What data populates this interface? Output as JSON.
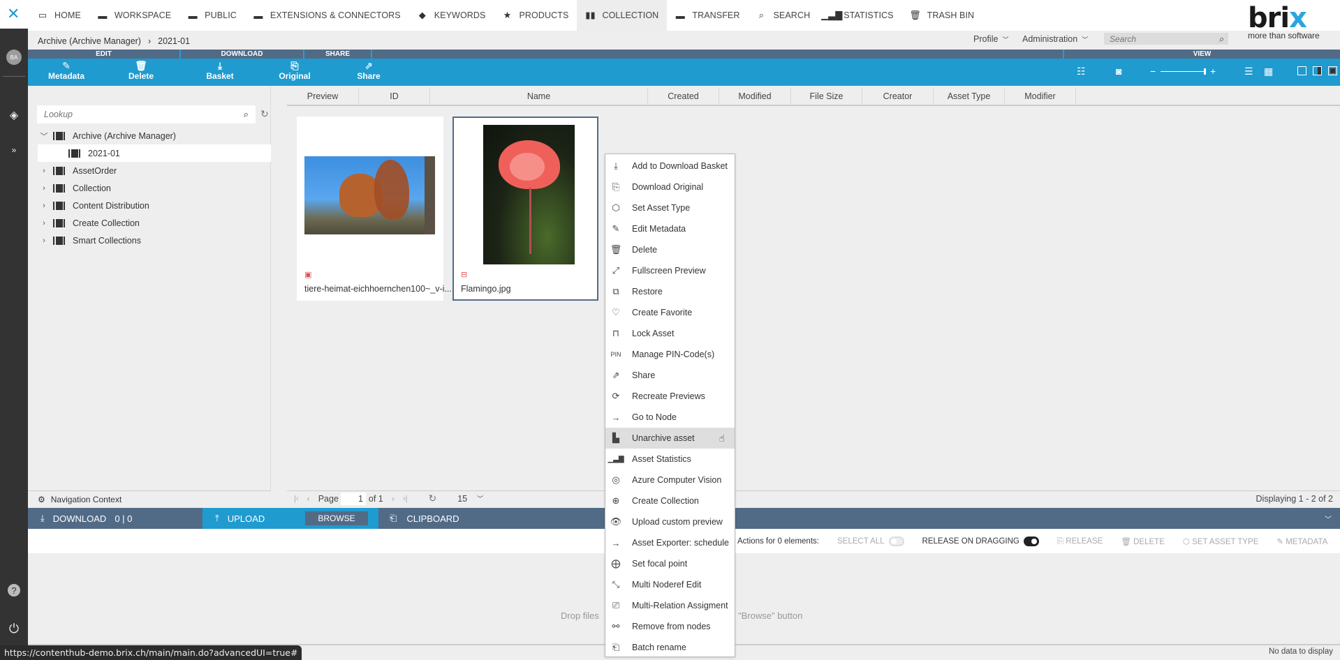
{
  "topnav": {
    "logo": "✕",
    "items": [
      {
        "label": "HOME",
        "icon": "monitor-icon"
      },
      {
        "label": "WORKSPACE",
        "icon": "folder-icon"
      },
      {
        "label": "PUBLIC",
        "icon": "folder-icon"
      },
      {
        "label": "EXTENSIONS & CONNECTORS",
        "icon": "folder-icon"
      },
      {
        "label": "KEYWORDS",
        "icon": "tag-icon"
      },
      {
        "label": "PRODUCTS",
        "icon": "star-icon"
      },
      {
        "label": "COLLECTION",
        "icon": "briefcase-icon",
        "active": true
      },
      {
        "label": "TRANSFER",
        "icon": "folder-icon"
      },
      {
        "label": "SEARCH",
        "icon": "search-icon"
      },
      {
        "label": "STATISTICS",
        "icon": "bar-chart-icon"
      },
      {
        "label": "TRASH BIN",
        "icon": "trash-icon"
      }
    ]
  },
  "brand": {
    "word_a": "bri",
    "word_b": "x",
    "tagline": "more than software"
  },
  "header": {
    "profile": "Profile",
    "administration": "Administration",
    "search_placeholder": "Search"
  },
  "sidebar": {
    "avatar": "BA"
  },
  "breadcrumb": {
    "items": [
      "Archive (Archive Manager)",
      "2021-01"
    ],
    "separator": "›"
  },
  "sections": {
    "edit": "EDIT",
    "download": "DOWNLOAD",
    "share": "SHARE",
    "view": "VIEW"
  },
  "toolbar": {
    "metadata": "Metadata",
    "delete": "Delete",
    "basket": "Basket",
    "original": "Original",
    "share": "Share",
    "zoom_minus": "−",
    "zoom_plus": "+",
    "zoom_level": 1.0
  },
  "tree": {
    "lookup_placeholder": "Lookup",
    "nodes": [
      {
        "label": "Archive (Archive Manager)",
        "expanded": true
      },
      {
        "label": "2021-01",
        "selected": true
      },
      {
        "label": "AssetOrder"
      },
      {
        "label": "Collection"
      },
      {
        "label": "Content Distribution"
      },
      {
        "label": "Create Collection"
      },
      {
        "label": "Smart Collections"
      }
    ],
    "nav_context": "Navigation Context"
  },
  "columns": [
    "Preview",
    "ID",
    "Name",
    "Created",
    "Modified",
    "File Size",
    "Creator",
    "Asset Type",
    "Modifier"
  ],
  "assets": [
    {
      "name": "tiere-heimat-eichhoernchen100~_v-i...",
      "type_icon": "image-file-icon",
      "subject": "squirrel"
    },
    {
      "name": "Flamingo.jpg",
      "type_icon": "file-icon",
      "subject": "flamingo",
      "selected": true
    }
  ],
  "pager": {
    "page_label": "Page",
    "page": "1",
    "of_label": "of 1",
    "page_size": "15",
    "displaying": "Displaying 1 - 2 of 2"
  },
  "bottombar": {
    "download": "DOWNLOAD",
    "download_count": "0 | 0",
    "upload": "UPLOAD",
    "browse": "BROWSE",
    "clipboard": "CLIPBOARD"
  },
  "clipboard_actions": {
    "actions_for": "Actions for 0 elements:",
    "select_all": "SELECT ALL",
    "select_all_on": false,
    "release_on_dragging": "RELEASE ON DRAGGING",
    "release_on_dragging_on": true,
    "release": "RELEASE",
    "delete": "DELETE",
    "set_asset_type": "SET ASSET TYPE",
    "metadata": "METADATA"
  },
  "dropzone": {
    "left": "Drop files",
    "right": "\"Browse\" button"
  },
  "status": {
    "no_data": "No data to display",
    "url": "https://contenthub-demo.brix.ch/main/main.do?advancedUI=true#"
  },
  "context_menu": {
    "items": [
      {
        "label": "Add to Download Basket",
        "icon": "download-tray-icon"
      },
      {
        "label": "Download Original",
        "icon": "file-download-icon"
      },
      {
        "label": "Set Asset Type",
        "icon": "cube-icon"
      },
      {
        "label": "Edit Metadata",
        "icon": "edit-icon"
      },
      {
        "label": "Delete",
        "icon": "trash-icon"
      },
      {
        "label": "Fullscreen Preview",
        "icon": "expand-icon"
      },
      {
        "label": "Restore",
        "icon": "restore-icon"
      },
      {
        "label": "Create Favorite",
        "icon": "heart-icon"
      },
      {
        "label": "Lock Asset",
        "icon": "lock-icon"
      },
      {
        "label": "Manage PIN-Code(s)",
        "icon": "pin-text-icon"
      },
      {
        "label": "Share",
        "icon": "share-icon"
      },
      {
        "label": "Recreate Previews",
        "icon": "refresh-box-icon"
      },
      {
        "label": "Go to Node",
        "icon": "arrow-right-icon"
      },
      {
        "label": "Unarchive asset",
        "icon": "unarchive-folder-icon",
        "hover": true
      },
      {
        "label": "Asset Statistics",
        "icon": "bar-chart-icon"
      },
      {
        "label": "Azure Computer Vision",
        "icon": "vision-icon"
      },
      {
        "label": "Create Collection",
        "icon": "collection-add-icon"
      },
      {
        "label": "Upload custom preview",
        "icon": "eye-upload-icon"
      },
      {
        "label": "Asset Exporter: schedule",
        "icon": "arrow-right-icon"
      },
      {
        "label": "Set focal point",
        "icon": "crosshair-icon"
      },
      {
        "label": "Multi Noderef Edit",
        "icon": "nodes-edit-icon"
      },
      {
        "label": "Multi-Relation Assigment",
        "icon": "relation-icon"
      },
      {
        "label": "Remove from nodes",
        "icon": "unlink-icon"
      },
      {
        "label": "Batch rename",
        "icon": "rename-icon"
      }
    ]
  }
}
